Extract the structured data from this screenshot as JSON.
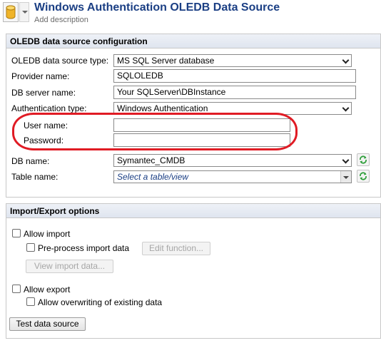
{
  "header": {
    "title": "Windows Authentication OLEDB Data Source",
    "description": "Add description"
  },
  "oledb_section": {
    "heading": "OLEDB data source configuration",
    "source_type": {
      "label": "OLEDB data source type:",
      "value": "MS SQL Server database"
    },
    "provider": {
      "label": "Provider name:",
      "value": "SQLOLEDB"
    },
    "server": {
      "label": "DB server name:",
      "value": "Your SQLServer\\DBInstance"
    },
    "auth_type": {
      "label": "Authentication type:",
      "value": "Windows Authentication"
    },
    "user_name": {
      "label": "User name:",
      "value": ""
    },
    "password": {
      "label": "Password:",
      "value": ""
    },
    "db_name": {
      "label": "DB name:",
      "value": "Symantec_CMDB"
    },
    "table_name": {
      "label": "Table name:",
      "placeholder": "Select a table/view"
    }
  },
  "import_export_section": {
    "heading": "Import/Export options",
    "allow_import": {
      "label": "Allow import",
      "checked": false
    },
    "preprocess_import": {
      "label": "Pre-process import data",
      "checked": false
    },
    "edit_function_label": "Edit function...",
    "view_import_label": "View import data...",
    "allow_export": {
      "label": "Allow export",
      "checked": false
    },
    "allow_overwriting": {
      "label": "Allow overwriting of existing data",
      "checked": false
    }
  },
  "test_button_label": "Test data source",
  "colors": {
    "title": "#1b3f84",
    "highlight_oval": "#e01b24",
    "refresh_icon": "#2e9e3a"
  }
}
